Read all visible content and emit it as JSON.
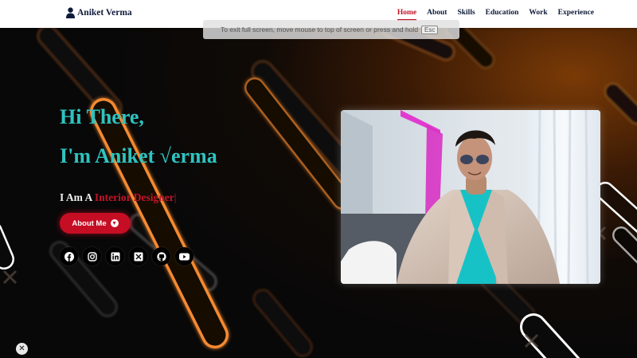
{
  "navbar": {
    "brand": "Aniket Verma",
    "items": [
      {
        "label": "Home",
        "active": true
      },
      {
        "label": "About",
        "active": false
      },
      {
        "label": "Skills",
        "active": false
      },
      {
        "label": "Education",
        "active": false
      },
      {
        "label": "Work",
        "active": false
      },
      {
        "label": "Experience",
        "active": false
      }
    ]
  },
  "fullscreen_notice": {
    "text": "To exit full screen, move mouse to top of screen or press and hold",
    "key": "Esc"
  },
  "hero": {
    "greeting_line1": "Hi There,",
    "greeting_line2": "I'm Aniket √erma",
    "tagline_prefix": "I Am A ",
    "tagline_role": "Interior Designer",
    "tagline_cursor": "|",
    "button_label": "About Me",
    "socials": [
      "facebook-icon",
      "instagram-icon",
      "linkedin-icon",
      "x-twitter-icon",
      "github-icon",
      "youtube-icon"
    ],
    "accent_color": "#2ec3c0",
    "primary_color": "#c50e24"
  },
  "close_button": "✕"
}
